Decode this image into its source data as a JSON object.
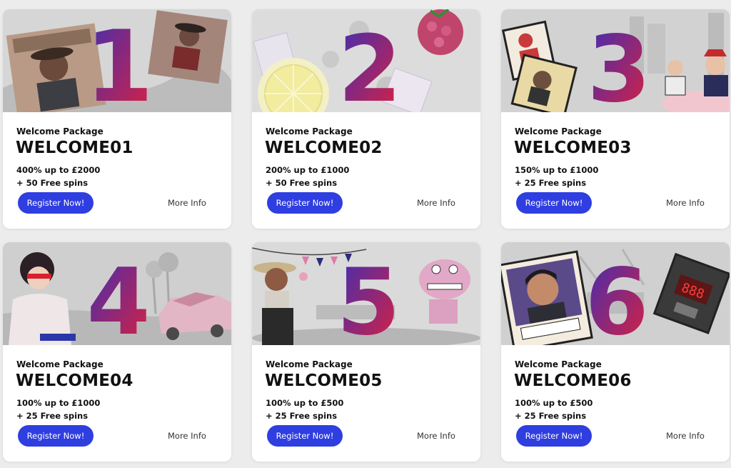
{
  "cards": [
    {
      "number": "1",
      "package": "Welcome Package",
      "code": "WELCOME01",
      "bonus": "400% up to £2000",
      "spins": "+ 50 Free spins",
      "register": "Register Now!",
      "more": "More Info"
    },
    {
      "number": "2",
      "package": "Welcome Package",
      "code": "WELCOME02",
      "bonus": "200% up to £1000",
      "spins": "+ 50 Free spins",
      "register": "Register Now!",
      "more": "More Info"
    },
    {
      "number": "3",
      "package": "Welcome Package",
      "code": "WELCOME03",
      "bonus": "150% up to £1000",
      "spins": "+ 25 Free spins",
      "register": "Register Now!",
      "more": "More Info"
    },
    {
      "number": "4",
      "package": "Welcome Package",
      "code": "WELCOME04",
      "bonus": "100% up to £1000",
      "spins": "+ 25 Free spins",
      "register": "Register Now!",
      "more": "More Info"
    },
    {
      "number": "5",
      "package": "Welcome Package",
      "code": "WELCOME05",
      "bonus": "100% up to £500",
      "spins": "+ 25 Free spins",
      "register": "Register Now!",
      "more": "More Info"
    },
    {
      "number": "6",
      "package": "Welcome Package",
      "code": "WELCOME06",
      "bonus": "100% up to £500",
      "spins": "+ 25 Free spins",
      "register": "Register Now!",
      "more": "More Info"
    }
  ],
  "colors": {
    "number_gradient_start": "#e2203a",
    "number_gradient_end": "#3a2fb5",
    "button": "#2f3ee0"
  }
}
